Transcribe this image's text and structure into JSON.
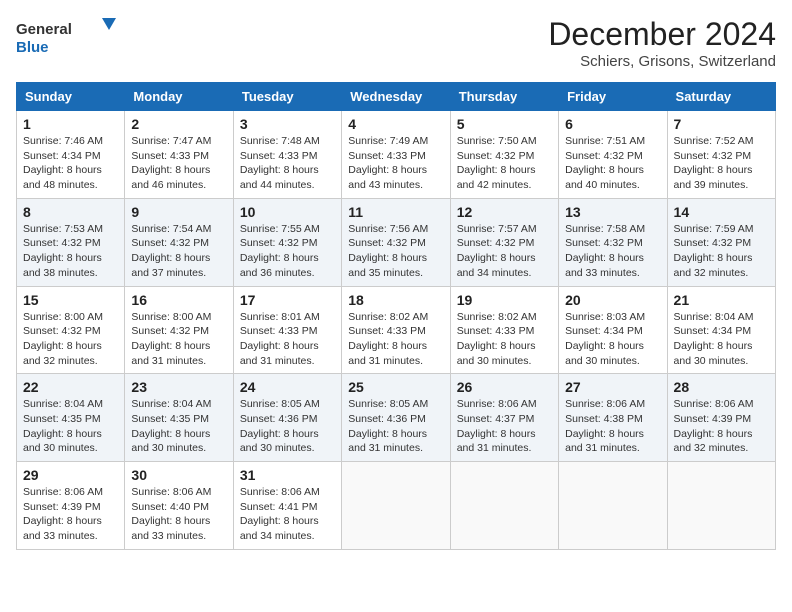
{
  "logo": {
    "text_general": "General",
    "text_blue": "Blue"
  },
  "title": {
    "month": "December 2024",
    "location": "Schiers, Grisons, Switzerland"
  },
  "weekdays": [
    "Sunday",
    "Monday",
    "Tuesday",
    "Wednesday",
    "Thursday",
    "Friday",
    "Saturday"
  ],
  "weeks": [
    [
      {
        "day": "1",
        "sunrise": "7:46 AM",
        "sunset": "4:34 PM",
        "daylight": "8 hours and 48 minutes."
      },
      {
        "day": "2",
        "sunrise": "7:47 AM",
        "sunset": "4:33 PM",
        "daylight": "8 hours and 46 minutes."
      },
      {
        "day": "3",
        "sunrise": "7:48 AM",
        "sunset": "4:33 PM",
        "daylight": "8 hours and 44 minutes."
      },
      {
        "day": "4",
        "sunrise": "7:49 AM",
        "sunset": "4:33 PM",
        "daylight": "8 hours and 43 minutes."
      },
      {
        "day": "5",
        "sunrise": "7:50 AM",
        "sunset": "4:32 PM",
        "daylight": "8 hours and 42 minutes."
      },
      {
        "day": "6",
        "sunrise": "7:51 AM",
        "sunset": "4:32 PM",
        "daylight": "8 hours and 40 minutes."
      },
      {
        "day": "7",
        "sunrise": "7:52 AM",
        "sunset": "4:32 PM",
        "daylight": "8 hours and 39 minutes."
      }
    ],
    [
      {
        "day": "8",
        "sunrise": "7:53 AM",
        "sunset": "4:32 PM",
        "daylight": "8 hours and 38 minutes."
      },
      {
        "day": "9",
        "sunrise": "7:54 AM",
        "sunset": "4:32 PM",
        "daylight": "8 hours and 37 minutes."
      },
      {
        "day": "10",
        "sunrise": "7:55 AM",
        "sunset": "4:32 PM",
        "daylight": "8 hours and 36 minutes."
      },
      {
        "day": "11",
        "sunrise": "7:56 AM",
        "sunset": "4:32 PM",
        "daylight": "8 hours and 35 minutes."
      },
      {
        "day": "12",
        "sunrise": "7:57 AM",
        "sunset": "4:32 PM",
        "daylight": "8 hours and 34 minutes."
      },
      {
        "day": "13",
        "sunrise": "7:58 AM",
        "sunset": "4:32 PM",
        "daylight": "8 hours and 33 minutes."
      },
      {
        "day": "14",
        "sunrise": "7:59 AM",
        "sunset": "4:32 PM",
        "daylight": "8 hours and 32 minutes."
      }
    ],
    [
      {
        "day": "15",
        "sunrise": "8:00 AM",
        "sunset": "4:32 PM",
        "daylight": "8 hours and 32 minutes."
      },
      {
        "day": "16",
        "sunrise": "8:00 AM",
        "sunset": "4:32 PM",
        "daylight": "8 hours and 31 minutes."
      },
      {
        "day": "17",
        "sunrise": "8:01 AM",
        "sunset": "4:33 PM",
        "daylight": "8 hours and 31 minutes."
      },
      {
        "day": "18",
        "sunrise": "8:02 AM",
        "sunset": "4:33 PM",
        "daylight": "8 hours and 31 minutes."
      },
      {
        "day": "19",
        "sunrise": "8:02 AM",
        "sunset": "4:33 PM",
        "daylight": "8 hours and 30 minutes."
      },
      {
        "day": "20",
        "sunrise": "8:03 AM",
        "sunset": "4:34 PM",
        "daylight": "8 hours and 30 minutes."
      },
      {
        "day": "21",
        "sunrise": "8:04 AM",
        "sunset": "4:34 PM",
        "daylight": "8 hours and 30 minutes."
      }
    ],
    [
      {
        "day": "22",
        "sunrise": "8:04 AM",
        "sunset": "4:35 PM",
        "daylight": "8 hours and 30 minutes."
      },
      {
        "day": "23",
        "sunrise": "8:04 AM",
        "sunset": "4:35 PM",
        "daylight": "8 hours and 30 minutes."
      },
      {
        "day": "24",
        "sunrise": "8:05 AM",
        "sunset": "4:36 PM",
        "daylight": "8 hours and 30 minutes."
      },
      {
        "day": "25",
        "sunrise": "8:05 AM",
        "sunset": "4:36 PM",
        "daylight": "8 hours and 31 minutes."
      },
      {
        "day": "26",
        "sunrise": "8:06 AM",
        "sunset": "4:37 PM",
        "daylight": "8 hours and 31 minutes."
      },
      {
        "day": "27",
        "sunrise": "8:06 AM",
        "sunset": "4:38 PM",
        "daylight": "8 hours and 31 minutes."
      },
      {
        "day": "28",
        "sunrise": "8:06 AM",
        "sunset": "4:39 PM",
        "daylight": "8 hours and 32 minutes."
      }
    ],
    [
      {
        "day": "29",
        "sunrise": "8:06 AM",
        "sunset": "4:39 PM",
        "daylight": "8 hours and 33 minutes."
      },
      {
        "day": "30",
        "sunrise": "8:06 AM",
        "sunset": "4:40 PM",
        "daylight": "8 hours and 33 minutes."
      },
      {
        "day": "31",
        "sunrise": "8:06 AM",
        "sunset": "4:41 PM",
        "daylight": "8 hours and 34 minutes."
      },
      null,
      null,
      null,
      null
    ]
  ],
  "labels": {
    "sunrise": "Sunrise:",
    "sunset": "Sunset:",
    "daylight": "Daylight:"
  }
}
